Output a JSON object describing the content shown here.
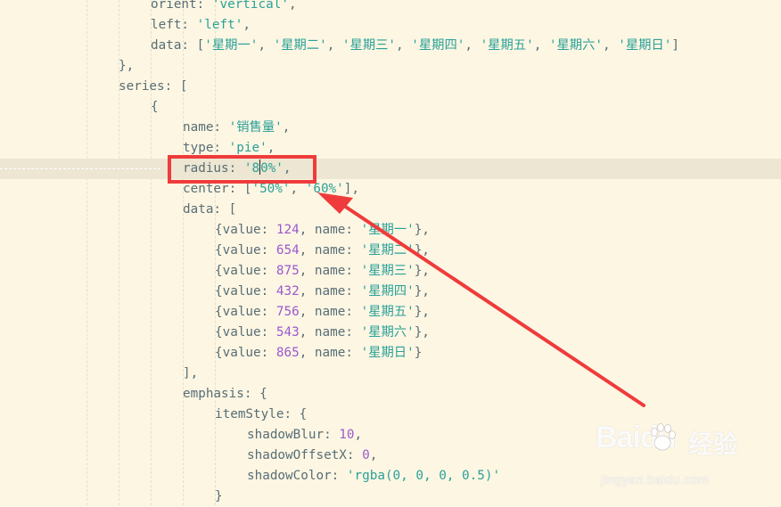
{
  "lines": [
    {
      "text": "orient: 'vertical',"
    },
    {
      "text": "left: 'left',"
    },
    {
      "text": "data: ['星期一', '星期二', '星期三', '星期四', '星期五', '星期六', '星期日']"
    },
    {
      "text": "},"
    },
    {
      "text": "series: ["
    },
    {
      "text": "{"
    },
    {
      "text": "name: '销售量',"
    },
    {
      "text": "type: 'pie',"
    },
    {
      "text": "radius: '80%',"
    },
    {
      "text": "center: ['50%', '60%'],"
    },
    {
      "text": "data: ["
    },
    {
      "text": "{value: 124, name: '星期一'},"
    },
    {
      "text": "{value: 654, name: '星期二'},"
    },
    {
      "text": "{value: 875, name: '星期三'},"
    },
    {
      "text": "{value: 432, name: '星期四'},"
    },
    {
      "text": "{value: 756, name: '星期五'},"
    },
    {
      "text": "{value: 543, name: '星期六'},"
    },
    {
      "text": "{value: 865, name: '星期日'}"
    },
    {
      "text": "],"
    },
    {
      "text": "emphasis: {"
    },
    {
      "text": "itemStyle: {"
    },
    {
      "text": "shadowBlur: 10,"
    },
    {
      "text": "shadowOffsetX: 0,"
    },
    {
      "text": "shadowColor: 'rgba(0, 0, 0, 0.5)'"
    },
    {
      "text": "}"
    }
  ],
  "annotation": {
    "box_color": "#ef3b3b",
    "arrow_color": "#ef3b3b"
  },
  "watermark": {
    "brand": "Baidu",
    "product": "经验",
    "url": "jingyan.baidu.com"
  },
  "colors": {
    "background": "#fdf6e3",
    "string": "#2aa198",
    "number": "#9b59d0",
    "plain": "#586e75"
  }
}
